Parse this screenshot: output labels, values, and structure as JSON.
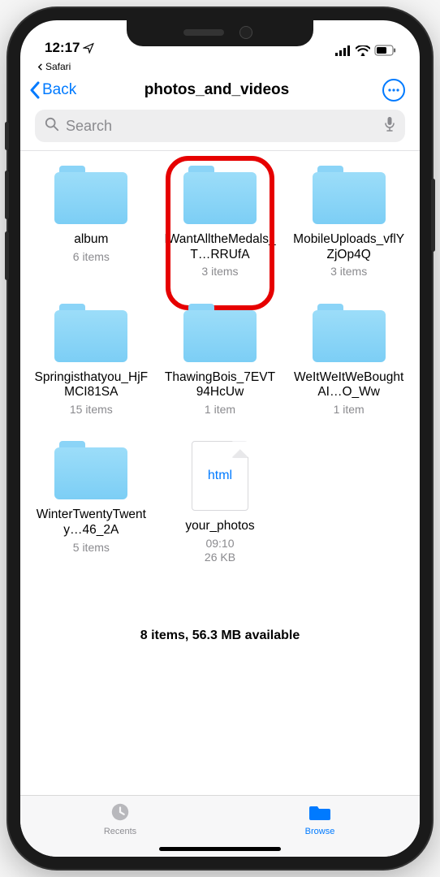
{
  "status": {
    "time": "12:17",
    "return_app": "Safari"
  },
  "nav": {
    "back_label": "Back",
    "title": "photos_and_videos"
  },
  "search": {
    "placeholder": "Search"
  },
  "items": [
    {
      "name": "album",
      "meta": "6 items"
    },
    {
      "name": "IWantAlltheMedals_T…RRUfA",
      "meta": "3 items"
    },
    {
      "name": "MobileUploads_vflYZjOp4Q",
      "meta": "3 items"
    },
    {
      "name": "Springisthatyou_HjFMCI81SA",
      "meta": "15 items"
    },
    {
      "name": "ThawingBois_7EVT94HcUw",
      "meta": "1 item"
    },
    {
      "name": "WeItWeItWeBoughtAI…O_Ww",
      "meta": "1 item"
    },
    {
      "name": "WinterTwentyTwenty…46_2A",
      "meta": "5 items"
    },
    {
      "name": "your_photos",
      "meta": "09:10\n26 KB",
      "file_label": "html"
    }
  ],
  "footer": {
    "status": "8 items, 56.3 MB available"
  },
  "tabs": {
    "recents": "Recents",
    "browse": "Browse"
  }
}
